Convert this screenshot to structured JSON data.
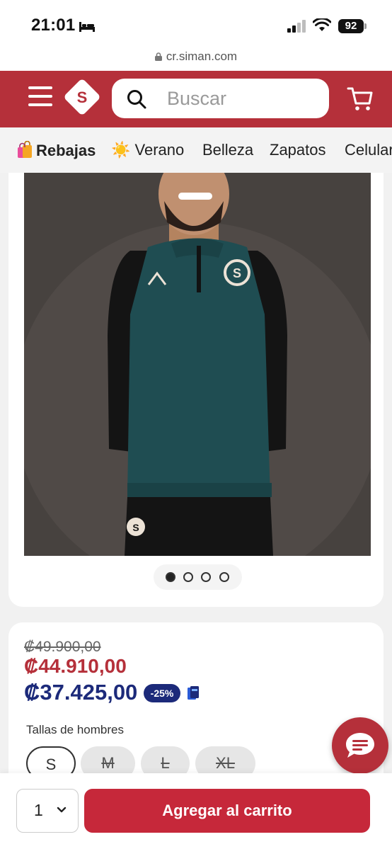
{
  "status_bar": {
    "time": "21:01",
    "battery": "92",
    "sleep_icon": "bed-icon"
  },
  "url": "cr.siman.com",
  "header": {
    "logo_letter": "S",
    "search_placeholder": "Buscar",
    "brand_color": "#b5303a"
  },
  "categories": [
    {
      "label": "Rebajas",
      "icon": "shopping-bags-emoji"
    },
    {
      "label": "Verano",
      "icon": "sun-emoji",
      "icon_glyph": "☀️"
    },
    {
      "label": "Belleza"
    },
    {
      "label": "Zapatos"
    },
    {
      "label": "Celular"
    }
  ],
  "gallery": {
    "image_count": 4,
    "active_index": 0
  },
  "price": {
    "original": "₡49.900,00",
    "sale": "₡44.910,00",
    "final": "₡37.425,00",
    "discount_badge": "-25%",
    "accent_blue": "#1c2a7a"
  },
  "sizes": {
    "label": "Tallas de hombres",
    "options": [
      {
        "label": "S",
        "available": true
      },
      {
        "label": "M",
        "available": false
      },
      {
        "label": "L",
        "available": false
      },
      {
        "label": "XL",
        "available": false
      }
    ]
  },
  "cart_bar": {
    "quantity": "1",
    "add_button": "Agregar al carrito"
  }
}
